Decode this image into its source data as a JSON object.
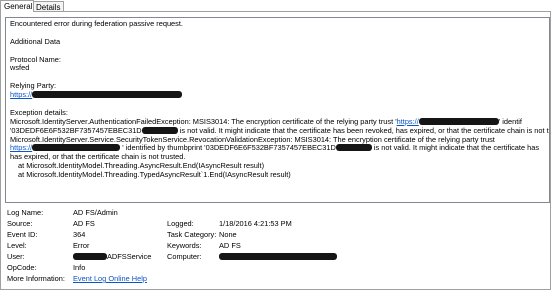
{
  "tabs": [
    {
      "label": "General",
      "active": true
    },
    {
      "label": "Details",
      "active": false
    }
  ],
  "description": {
    "line1": "Encountered error during federation passive request.",
    "additional_data": "Additional Data",
    "protocol_label": "Protocol Name:",
    "protocol_value": "wsfed",
    "rp_label": "Relying Party:",
    "rp_url_prefix": "https://",
    "exception_label": "Exception details:",
    "exc1_a": "Microsoft.IdentityServer.AuthenticationFailedException: MSIS3014: The encryption certificate of the relying party trust '",
    "exc1_link": "https://",
    "exc1_b": "' identif",
    "exc2_a": "'03DEDF6E6F532BF7357457EBEC31D",
    "exc2_b": "is not valid. It might indicate that the certificate has been revoked, has expired, or that the certificate chain is not trusted. ---",
    "exc3": "Microsoft.IdentityServer.Service.SecurityTokenService.RevocationValidationException: MSIS3014: The encryption certificate of the relying party trust",
    "exc4_link": "https://",
    "exc4_a": "' identified by thumbprint '03DEDF6E6F532BF7357457EBEC31D",
    "exc4_b": "is not valid. It might indicate that the certificate has",
    "exc5": "has expired, or that the certificate chain is not trusted.",
    "stack1": "at Microsoft.IdentityModel.Threading.AsyncResult.End(IAsyncResult result)",
    "stack2": "at Microsoft.IdentityModel.Threading.TypedAsyncResult`1.End(IAsyncResult result)"
  },
  "details": {
    "log_name_label": "Log Name:",
    "log_name_value": "AD FS/Admin",
    "source_label": "Source:",
    "source_value": "AD FS",
    "logged_label": "Logged:",
    "logged_value": "1/18/2016 4:21:53 PM",
    "event_id_label": "Event ID:",
    "event_id_value": "364",
    "task_category_label": "Task Category:",
    "task_category_value": "None",
    "level_label": "Level:",
    "level_value": "Error",
    "keywords_label": "Keywords:",
    "keywords_value": "AD FS",
    "user_label": "User:",
    "user_value_suffix": "ADFSService",
    "computer_label": "Computer:",
    "opcode_label": "OpCode:",
    "opcode_value": "Info",
    "more_info_label": "More Information:",
    "more_info_link": "Event Log Online Help"
  },
  "colors": {
    "link": "#0b55c8",
    "border": "#a0a0a0",
    "redaction": "#000000"
  }
}
